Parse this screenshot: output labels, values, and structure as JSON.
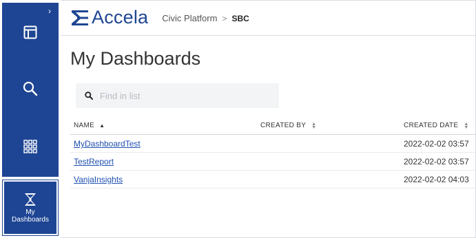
{
  "app": {
    "logo_text": "Accela"
  },
  "breadcrumb": {
    "parent": "Civic Platform",
    "separator": ">",
    "current": "SBC"
  },
  "sidebar": {
    "items": [
      {
        "name": "layout",
        "icon": "window-layout-icon"
      },
      {
        "name": "search",
        "icon": "search-icon"
      },
      {
        "name": "apps",
        "icon": "grid-apps-icon"
      }
    ],
    "active": {
      "label_line1": "My",
      "label_line2": "Dashboards",
      "icon": "hourglass-dashboards-icon"
    },
    "collapse_icon": "chevron-right-icon"
  },
  "page": {
    "title": "My Dashboards"
  },
  "search": {
    "placeholder": "Find in list",
    "value": ""
  },
  "table": {
    "columns": [
      {
        "label": "NAME",
        "sort": "asc"
      },
      {
        "label": "CREATED BY",
        "sort": "none"
      },
      {
        "label": "CREATED DATE",
        "sort": "none"
      }
    ],
    "rows": [
      {
        "name": "MyDashboardTest",
        "created_by": "",
        "created_date": "2022-02-02 03:57"
      },
      {
        "name": "TestReport",
        "created_by": "",
        "created_date": "2022-02-02 03:57"
      },
      {
        "name": "VanjaInsights",
        "created_by": "",
        "created_date": "2022-02-02 04:03"
      }
    ]
  },
  "colors": {
    "brand": "#1e4593",
    "link": "#1e4fb0",
    "search_bg": "#f2f4f6"
  }
}
